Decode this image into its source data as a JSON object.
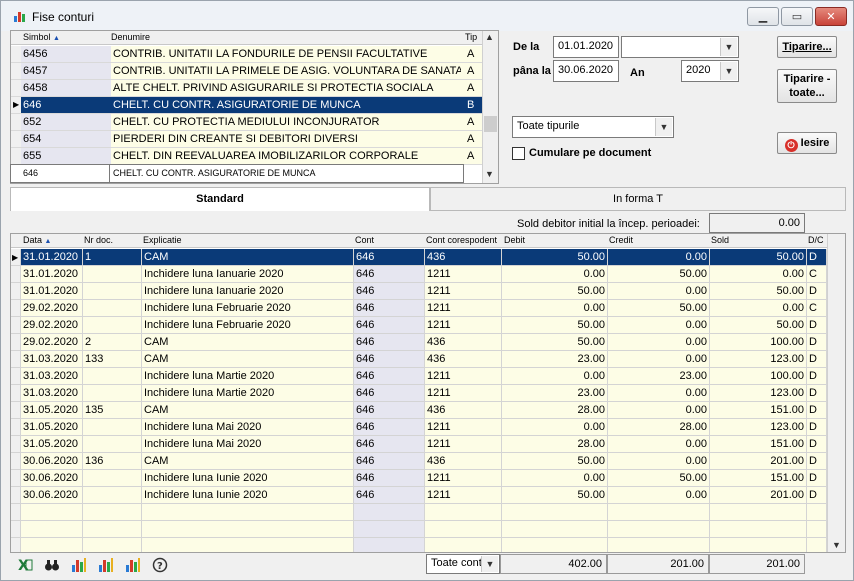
{
  "window": {
    "title": "Fise conturi",
    "accent": "#0a3a78"
  },
  "accounts": {
    "headers": {
      "simbol": "Simbol",
      "denumire": "Denumire",
      "tip": "Tip"
    },
    "rows": [
      {
        "simbol": "6456",
        "denumire": "CONTRIB. UNITATII LA FONDURILE DE PENSII FACULTATIVE",
        "tip": "A"
      },
      {
        "simbol": "6457",
        "denumire": "CONTRIB. UNITATII LA PRIMELE DE ASIG. VOLUNTARA DE SANATATE",
        "tip": "A"
      },
      {
        "simbol": "6458",
        "denumire": "ALTE CHELT. PRIVIND ASIGURARILE SI PROTECTIA SOCIALA",
        "tip": "A"
      },
      {
        "simbol": "646",
        "denumire": "CHELT. CU CONTR. ASIGURATORIE DE MUNCA",
        "tip": "B"
      },
      {
        "simbol": "652",
        "denumire": "CHELT. CU PROTECTIA MEDIULUI INCONJURATOR",
        "tip": "A"
      },
      {
        "simbol": "654",
        "denumire": "PIERDERI DIN CREANTE SI DEBITORI DIVERSI",
        "tip": "A"
      },
      {
        "simbol": "655",
        "denumire": "CHELT. DIN REEVALUAREA IMOBILIZARILOR CORPORALE",
        "tip": "A"
      }
    ],
    "selected_index": 3,
    "current": {
      "simbol": "646",
      "denumire": "CHELT. CU CONTR. ASIGURATORIE DE MUNCA"
    }
  },
  "filters": {
    "de_la_label": "De la",
    "de_la_value": "01.01.2020",
    "pana_la_label": "pâna la",
    "pana_la_value": "30.06.2020",
    "an_label": "An",
    "an_value": "2020",
    "extra_combo_value": "",
    "tipuri_value": "Toate tipurile",
    "cumulare_label": "Cumulare pe document",
    "cumulare_checked": false
  },
  "buttons": {
    "tiparire": "Tiparire...",
    "tiparire_toate_1": "Tiparire -",
    "tiparire_toate_2": "toate...",
    "iesire": "Iesire"
  },
  "tabs": {
    "standard": "Standard",
    "forma_t": "In forma T"
  },
  "sold_initial": {
    "label": "Sold debitor initial la încep. perioadei:",
    "value": "0.00"
  },
  "entries": {
    "headers": {
      "data": "Data",
      "nr_doc": "Nr doc.",
      "explicatie": "Explicatie",
      "cont": "Cont",
      "cont_corespondent": "Cont corespodent",
      "debit": "Debit",
      "credit": "Credit",
      "sold": "Sold",
      "dc": "D/C"
    },
    "rows": [
      {
        "data": "31.01.2020",
        "nr_doc": "1",
        "explicatie": "CAM",
        "cont": "646",
        "cc": "436",
        "debit": "50.00",
        "credit": "0.00",
        "sold": "50.00",
        "dc": "D"
      },
      {
        "data": "31.01.2020",
        "nr_doc": "",
        "explicatie": "Inchidere luna Ianuarie     2020",
        "cont": "646",
        "cc": "1211",
        "debit": "0.00",
        "credit": "50.00",
        "sold": "0.00",
        "dc": "C"
      },
      {
        "data": "31.01.2020",
        "nr_doc": "",
        "explicatie": "Inchidere luna Ianuarie     2020",
        "cont": "646",
        "cc": "1211",
        "debit": "50.00",
        "credit": "0.00",
        "sold": "50.00",
        "dc": "D"
      },
      {
        "data": "29.02.2020",
        "nr_doc": "",
        "explicatie": "Inchidere luna Februarie     2020",
        "cont": "646",
        "cc": "1211",
        "debit": "0.00",
        "credit": "50.00",
        "sold": "0.00",
        "dc": "C"
      },
      {
        "data": "29.02.2020",
        "nr_doc": "",
        "explicatie": "Inchidere luna Februarie     2020",
        "cont": "646",
        "cc": "1211",
        "debit": "50.00",
        "credit": "0.00",
        "sold": "50.00",
        "dc": "D"
      },
      {
        "data": "29.02.2020",
        "nr_doc": "2",
        "explicatie": "CAM",
        "cont": "646",
        "cc": "436",
        "debit": "50.00",
        "credit": "0.00",
        "sold": "100.00",
        "dc": "D"
      },
      {
        "data": "31.03.2020",
        "nr_doc": "133",
        "explicatie": "CAM",
        "cont": "646",
        "cc": "436",
        "debit": "23.00",
        "credit": "0.00",
        "sold": "123.00",
        "dc": "D"
      },
      {
        "data": "31.03.2020",
        "nr_doc": "",
        "explicatie": "Inchidere luna Martie     2020",
        "cont": "646",
        "cc": "1211",
        "debit": "0.00",
        "credit": "23.00",
        "sold": "100.00",
        "dc": "D"
      },
      {
        "data": "31.03.2020",
        "nr_doc": "",
        "explicatie": "Inchidere luna Martie     2020",
        "cont": "646",
        "cc": "1211",
        "debit": "23.00",
        "credit": "0.00",
        "sold": "123.00",
        "dc": "D"
      },
      {
        "data": "31.05.2020",
        "nr_doc": "135",
        "explicatie": "CAM",
        "cont": "646",
        "cc": "436",
        "debit": "28.00",
        "credit": "0.00",
        "sold": "151.00",
        "dc": "D"
      },
      {
        "data": "31.05.2020",
        "nr_doc": "",
        "explicatie": "Inchidere luna Mai     2020",
        "cont": "646",
        "cc": "1211",
        "debit": "0.00",
        "credit": "28.00",
        "sold": "123.00",
        "dc": "D"
      },
      {
        "data": "31.05.2020",
        "nr_doc": "",
        "explicatie": "Inchidere luna Mai     2020",
        "cont": "646",
        "cc": "1211",
        "debit": "28.00",
        "credit": "0.00",
        "sold": "151.00",
        "dc": "D"
      },
      {
        "data": "30.06.2020",
        "nr_doc": "136",
        "explicatie": "CAM",
        "cont": "646",
        "cc": "436",
        "debit": "50.00",
        "credit": "0.00",
        "sold": "201.00",
        "dc": "D"
      },
      {
        "data": "30.06.2020",
        "nr_doc": "",
        "explicatie": "Inchidere luna Iunie     2020",
        "cont": "646",
        "cc": "1211",
        "debit": "0.00",
        "credit": "50.00",
        "sold": "151.00",
        "dc": "D"
      },
      {
        "data": "30.06.2020",
        "nr_doc": "",
        "explicatie": "Inchidere luna Iunie     2020",
        "cont": "646",
        "cc": "1211",
        "debit": "50.00",
        "credit": "0.00",
        "sold": "201.00",
        "dc": "D"
      }
    ],
    "selected_index": 0,
    "empty_rows": 3
  },
  "totals": {
    "filter_value": "Toate cont",
    "debit": "402.00",
    "credit": "201.00",
    "sold": "201.00"
  },
  "footer_icons": [
    "excel-icon",
    "binoculars-icon",
    "chart-icon",
    "chart-icon",
    "chart-icon",
    "help-icon"
  ]
}
